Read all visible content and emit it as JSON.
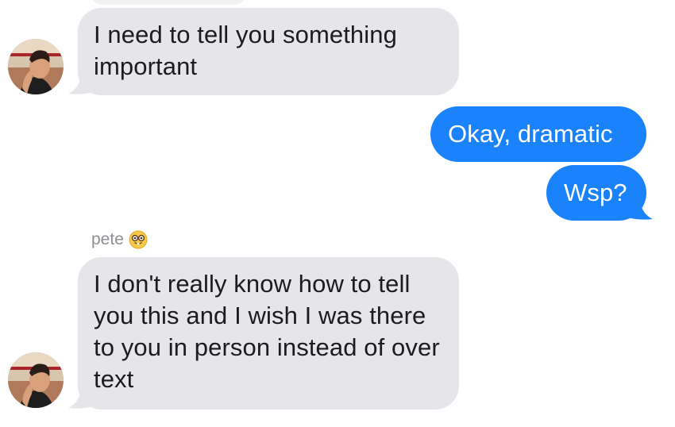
{
  "contact": {
    "name": "pete",
    "name_emoji": "nerd-face-emoji"
  },
  "messages": [
    {
      "direction": "incoming",
      "text": "I need to tell you something important"
    },
    {
      "direction": "outgoing",
      "text": "Okay, dramatic"
    },
    {
      "direction": "outgoing",
      "text": "Wsp?"
    },
    {
      "direction": "incoming",
      "text": "I don't really know how to tell you this and I wish I was there to you in person instead of over text"
    }
  ],
  "colors": {
    "incoming_bubble": "#e5e5ea",
    "outgoing_bubble": "#1a82fb",
    "sender_label": "#8e8e93"
  }
}
